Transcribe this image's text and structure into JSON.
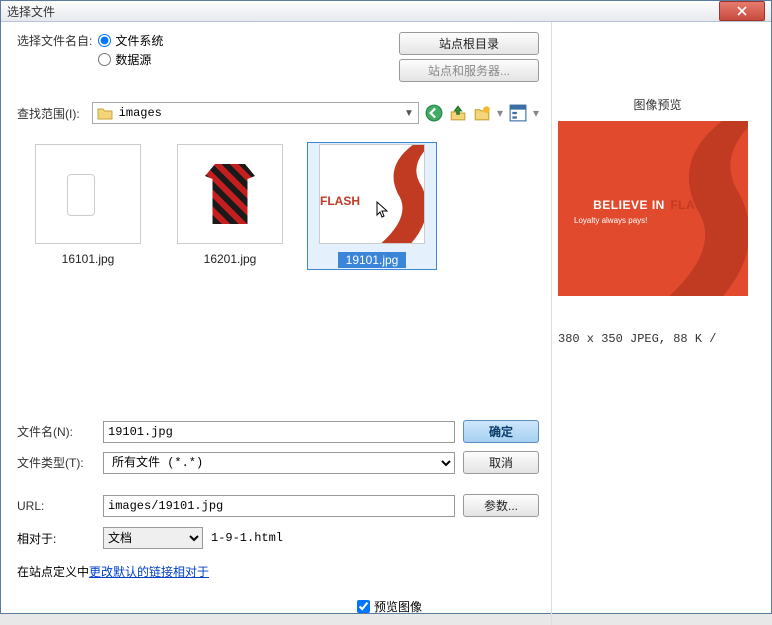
{
  "titlebar": {
    "title": "选择文件"
  },
  "sourceRow": {
    "label": "选择文件名自:",
    "radio1": "文件系统",
    "radio2": "数据源"
  },
  "topButtons": {
    "siteRoot": "站点根目录",
    "sitesServers": "站点和服务器..."
  },
  "lookIn": {
    "label": "查找范围(I):",
    "value": "images"
  },
  "files": [
    {
      "name": "16101.jpg"
    },
    {
      "name": "16201.jpg"
    },
    {
      "name": "19101.jpg"
    }
  ],
  "filename": {
    "label": "文件名(N):",
    "value": "19101.jpg"
  },
  "filetype": {
    "label": "文件类型(T):",
    "value": "所有文件 (*.*)"
  },
  "okBtn": "确定",
  "cancelBtn": "取消",
  "url": {
    "label": "URL:",
    "value": "images/19101.jpg"
  },
  "paramsBtn": "参数...",
  "relativeTo": {
    "label": "相对于:",
    "value": "文档",
    "file": "1-9-1.html"
  },
  "siteDef": {
    "prefix": "在站点定义中",
    "link": "更改默认的链接相对于"
  },
  "previewCheck": "预览图像",
  "preview": {
    "title": "图像预览",
    "text1a": "BELIEVE IN",
    "text1b": "FLASH",
    "text2": "Loyalty always pays!",
    "info": "380 x 350 JPEG, 88 K /"
  }
}
